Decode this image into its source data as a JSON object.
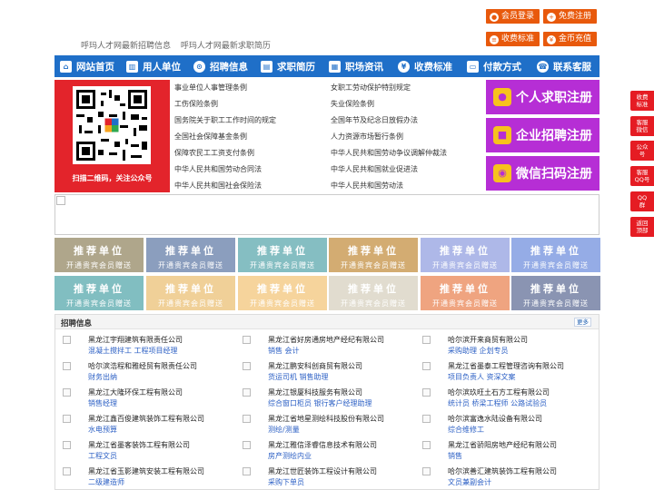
{
  "header": {
    "links": [
      "呼玛人才网最新招聘信息",
      "呼玛人才网最新求职简历"
    ],
    "buttons": {
      "login": "会员登录",
      "register": "免费注册",
      "fee": "收费标准",
      "recharge": "金币充值"
    }
  },
  "nav": {
    "items": [
      {
        "label": "网站首页",
        "icon": "home-icon"
      },
      {
        "label": "用人单位",
        "icon": "building-icon"
      },
      {
        "label": "招聘信息",
        "icon": "search-icon"
      },
      {
        "label": "求职简历",
        "icon": "document-icon"
      },
      {
        "label": "职场资讯",
        "icon": "news-icon"
      },
      {
        "label": "收费标准",
        "icon": "coin-icon"
      },
      {
        "label": "付款方式",
        "icon": "card-icon"
      },
      {
        "label": "联系客服",
        "icon": "phone-icon"
      }
    ]
  },
  "qr": {
    "caption": "扫描二维码，关注公众号"
  },
  "policies": {
    "left": [
      "事业单位人事管理条例",
      "工伤保险条例",
      "国务院关于职工工作时间的规定",
      "全国社会保障基金条例",
      "保障农民工工资支付条例",
      "中华人民共和国劳动合同法",
      "中华人民共和国社会保险法"
    ],
    "right": [
      "女职工劳动保护特别规定",
      "失业保险条例",
      "全国年节及纪念日放假办法",
      "人力资源市场暂行条例",
      "中华人民共和国劳动争议调解仲裁法",
      "中华人民共和国就业促进法",
      "中华人民共和国劳动法"
    ]
  },
  "register": {
    "seeker": "个人求职注册",
    "employer": "企业招聘注册",
    "wechat": "微信扫码注册"
  },
  "side": [
    {
      "line1": "收费",
      "line2": "标准"
    },
    {
      "line1": "客服",
      "line2": "微信"
    },
    {
      "line1": "公众",
      "line2": "号"
    },
    {
      "line1": "客服",
      "line2": "QQ号"
    },
    {
      "line1": "QQ",
      "line2": "群"
    },
    {
      "line1": "返回",
      "line2": "顶部"
    }
  ],
  "recommend": {
    "title": "推荐单位",
    "subtitle": "开通贵宾会员赠送",
    "colors": [
      "#6e5f2d",
      "#2e4f8a",
      "#238a91",
      "#b06a00",
      "#6d7fd6",
      "#3f6ad2",
      "#1b8a8f",
      "#e4ab45",
      "#f0b24d",
      "#c9c1a8",
      "#e25a1a",
      "#2b3e74"
    ]
  },
  "jobs": {
    "title": "招聘信息",
    "more": "更多",
    "columns": [
      [
        {
          "company": "黑龙江宇翔建筑有限责任公司",
          "positions": "混凝土搅拌工 工程项目经理"
        },
        {
          "company": "哈尔滨浩程和雅经贸有限责任公司",
          "positions": "财务出纳"
        },
        {
          "company": "黑龙江大隆环保工程有限公司",
          "positions": "销售经理"
        },
        {
          "company": "黑龙江鑫百俊建筑装饰工程有限公司",
          "positions": "水电预算"
        },
        {
          "company": "黑龙江省墨客装饰工程有限公司",
          "positions": "工程文员"
        },
        {
          "company": "黑龙江省玉影建筑安装工程有限公司",
          "positions": "二级建造师"
        }
      ],
      [
        {
          "company": "黑龙江省好房通房地产经纪有限公司",
          "positions": "销售 会计"
        },
        {
          "company": "黑龙江鹏安科创商贸有限公司",
          "positions": "货运司机 销售助理"
        },
        {
          "company": "黑龙江银厦科技服务有限公司",
          "positions": "综合窗口柜员 银行客户经理助理"
        },
        {
          "company": "黑龙江省地星测绘科技股份有限公司",
          "positions": "测绘/测量"
        },
        {
          "company": "黑龙江雅信泽睿信息技术有限公司",
          "positions": "房产测绘内业"
        },
        {
          "company": "黑龙江世匠装饰工程设计有限公司",
          "positions": "采购下单员"
        }
      ],
      [
        {
          "company": "哈尔滨开来商贸有限公司",
          "positions": "采购助理 企划专员"
        },
        {
          "company": "黑龙江省墨泰工程管理咨询有限公司",
          "positions": "项目负责人 资深文案"
        },
        {
          "company": "哈尔滨玖旺土石方工程有限公司",
          "positions": "统计员 桥梁工程师 公路试验员"
        },
        {
          "company": "哈尔滨富逸水陆设备有限公司",
          "positions": "综合维修工"
        },
        {
          "company": "黑龙江省骄阳房地产经纪有限公司",
          "positions": "销售"
        },
        {
          "company": "哈尔滨善汇建筑装饰工程有限公司",
          "positions": "文员兼副会计"
        }
      ]
    ]
  }
}
